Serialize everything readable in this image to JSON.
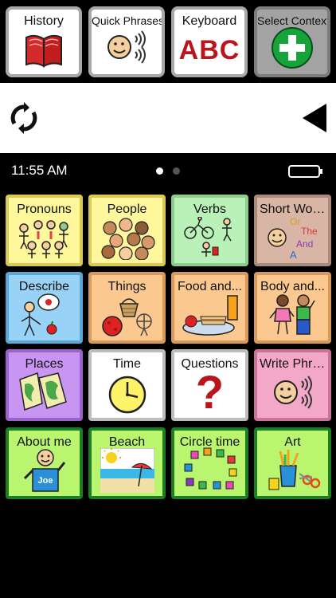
{
  "toolbar": {
    "history": "History",
    "quick_phrases": "Quick Phrases",
    "keyboard": "Keyboard",
    "keyboard_icon_text": "ABC",
    "select_context": "Select Context"
  },
  "status_bar": {
    "time": "11:55 AM",
    "page_count": 2,
    "current_page": 1
  },
  "tiles": {
    "pronouns": "Pronouns",
    "people": "People",
    "verbs": "Verbs",
    "short_words": "Short Words",
    "short_words_art": [
      "Or",
      "The",
      "And",
      "A"
    ],
    "describe": "Describe",
    "things": "Things",
    "food": "Food and...",
    "body": "Body and...",
    "places": "Places",
    "time": "Time",
    "questions": "Questions",
    "questions_art": "?",
    "write_phrases": "Write Phra...",
    "about_me": "About me",
    "about_me_art": "Joe",
    "beach": "Beach",
    "circle_time": "Circle time",
    "art": "Art"
  },
  "colors": {
    "pronouns": "#fef79c",
    "verbs": "#b9f1b9",
    "short_words": "#d9b5a5",
    "describe": "#98d2f6",
    "things": "#fbc890",
    "places": "#c896f2",
    "write_phrases": "#f2a8c6",
    "activities": "#b9f56e",
    "add_green": "#16a33a",
    "keyboard_red": "#b8161c"
  },
  "icons": {
    "history": "red-book-icon",
    "quick_phrases": "talking-face-icon",
    "keyboard": "abc-letters-icon",
    "select_context": "green-plus-icon",
    "refresh": "refresh-icon",
    "backspace": "back-triangle-icon",
    "battery": "battery-icon"
  }
}
